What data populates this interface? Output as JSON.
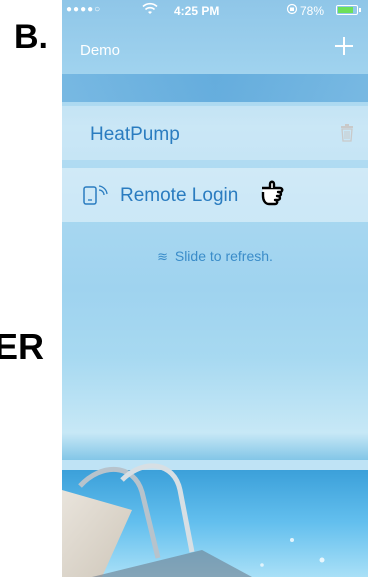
{
  "figure_label": "B.",
  "side_label": "ER",
  "status_bar": {
    "signal": "●●●●○",
    "wifi_icon": "wifi-icon",
    "time": "4:25 PM",
    "lock_icon": "orientation-lock-icon",
    "battery_percent": "78%",
    "battery_level": 0.78
  },
  "nav": {
    "title": "Demo",
    "add_icon": "plus-icon"
  },
  "devices": [
    {
      "label": "HeatPump",
      "icon": "trash-icon"
    },
    {
      "label": "Remote Login",
      "icon": "remote-device-icon",
      "pointer_icon": "pointing-hand-icon"
    }
  ],
  "refresh": {
    "icon": "chevron-double-down-icon",
    "text": "Slide to refresh."
  },
  "colors": {
    "accent": "#2a7cc0",
    "battery": "#6de05a"
  }
}
